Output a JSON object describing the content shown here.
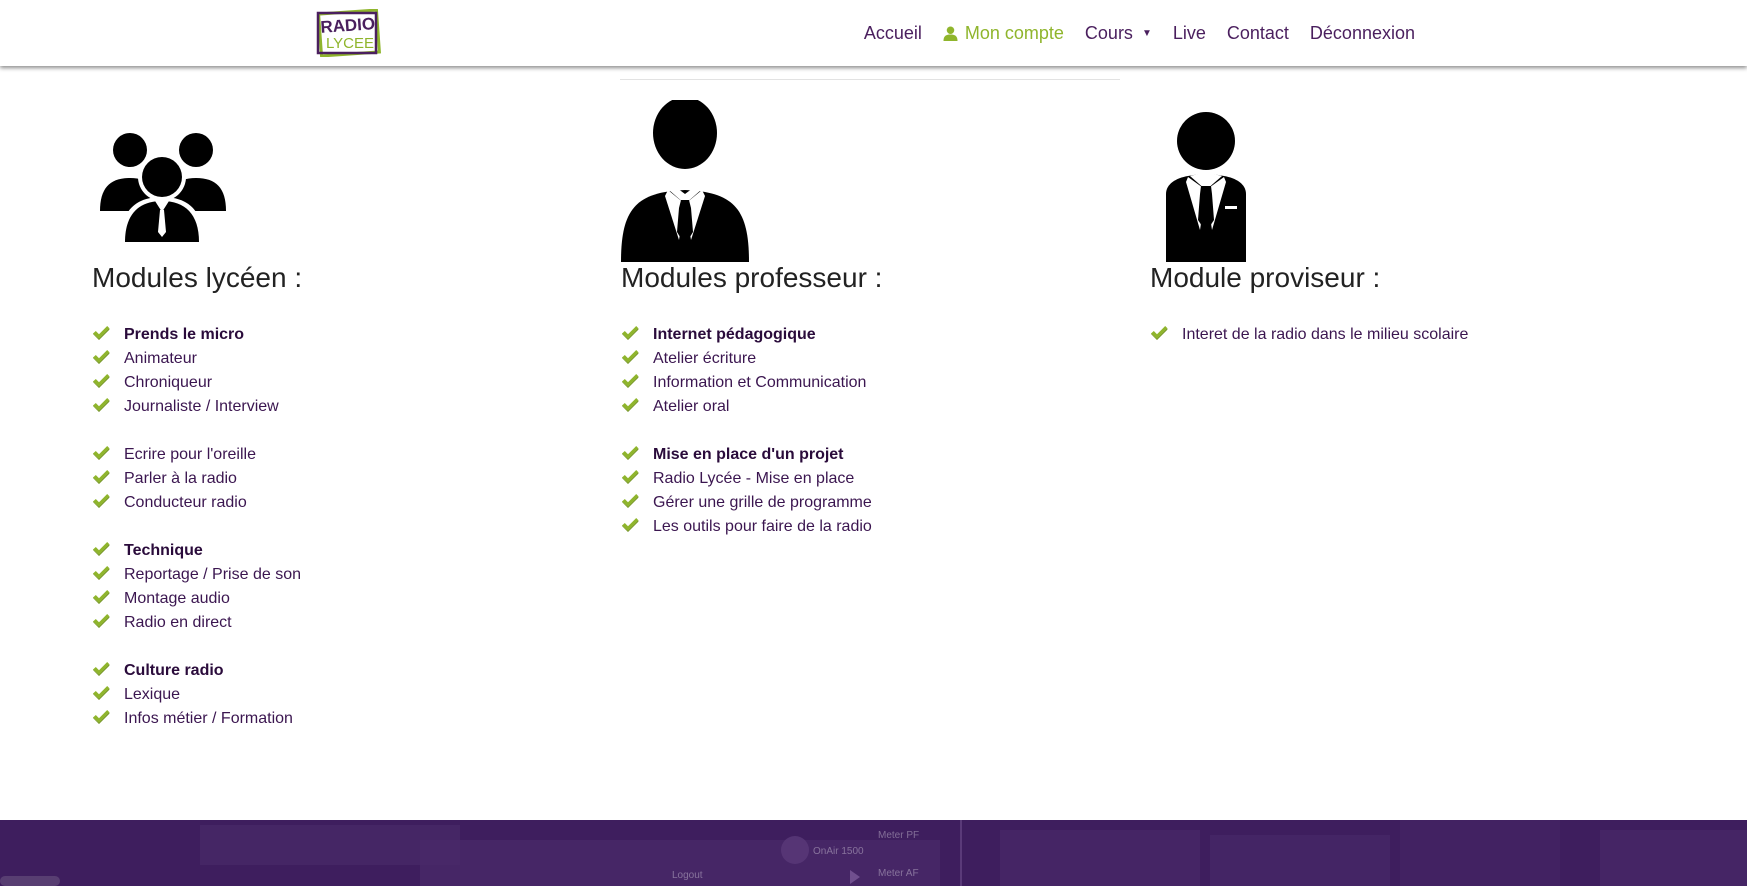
{
  "colors": {
    "brand_purple": "#4a1f5e",
    "accent_green": "#8fb52c",
    "footer_bg": "#3e1e5e"
  },
  "logo": {
    "text_top": "RADIO",
    "text_bottom": "LYCEE"
  },
  "nav": {
    "items": [
      {
        "label": "Accueil"
      },
      {
        "label": "Mon compte",
        "icon": "user-icon",
        "active": true
      },
      {
        "label": "Cours",
        "icon": "caret-down-icon"
      },
      {
        "label": "Live"
      },
      {
        "label": "Contact"
      },
      {
        "label": "Déconnexion"
      }
    ]
  },
  "columns": [
    {
      "title": "Modules lycéen :",
      "icon": "group-people-icon",
      "items": [
        {
          "label": "Prends le micro",
          "bold": true
        },
        {
          "label": "Animateur"
        },
        {
          "label": "Chroniqueur"
        },
        {
          "label": "Journaliste / Interview"
        },
        {
          "label": "Ecrire pour l'oreille",
          "gap": true
        },
        {
          "label": "Parler à la radio"
        },
        {
          "label": "Conducteur radio"
        },
        {
          "label": "Technique",
          "bold": true,
          "gap": true
        },
        {
          "label": "Reportage / Prise de son"
        },
        {
          "label": "Montage audio"
        },
        {
          "label": "Radio en direct"
        },
        {
          "label": "Culture radio",
          "bold": true,
          "gap": true
        },
        {
          "label": "Lexique"
        },
        {
          "label": "Infos métier / Formation"
        }
      ]
    },
    {
      "title": "Modules professeur :",
      "icon": "teacher-silhouette-icon",
      "items": [
        {
          "label": "Internet pédagogique",
          "bold": true
        },
        {
          "label": "Atelier écriture"
        },
        {
          "label": "Information et Communication"
        },
        {
          "label": "Atelier oral"
        },
        {
          "label": "Mise en place d'un projet",
          "bold": true,
          "gap": true
        },
        {
          "label": "Radio Lycée - Mise en place"
        },
        {
          "label": "Gérer une grille de programme"
        },
        {
          "label": "Les outils pour faire de la radio"
        }
      ]
    },
    {
      "title": "Module proviseur :",
      "icon": "principal-silhouette-icon",
      "items": [
        {
          "label": "Interet de la radio dans le milieu scolaire"
        }
      ]
    }
  ],
  "footer": {
    "texts": [
      "OnAir 1500",
      "Meter PF",
      "Meter AF",
      "Logout"
    ]
  }
}
